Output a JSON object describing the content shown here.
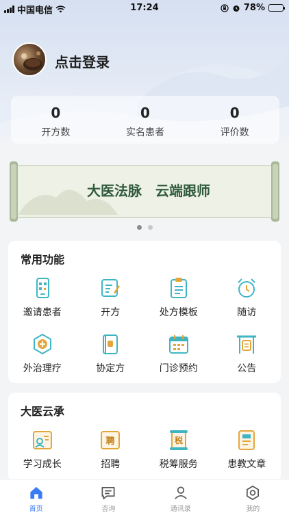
{
  "status_bar": {
    "carrier": "中国电信",
    "time": "17:24",
    "battery": "78%"
  },
  "profile": {
    "login_text": "点击登录"
  },
  "stats": [
    {
      "value": "0",
      "label": "开方数"
    },
    {
      "value": "0",
      "label": "实名患者"
    },
    {
      "value": "0",
      "label": "评价数"
    }
  ],
  "banner": {
    "text": "大医法脉　云端跟师",
    "slide_count": 2,
    "active_slide": 0
  },
  "common_functions": {
    "title": "常用功能",
    "items": [
      {
        "label": "邀请患者",
        "icon": "qr-phone-icon"
      },
      {
        "label": "开方",
        "icon": "prescribe-pen-icon"
      },
      {
        "label": "处方模板",
        "icon": "clipboard-template-icon"
      },
      {
        "label": "随访",
        "icon": "alarm-clock-icon"
      },
      {
        "label": "外治理疗",
        "icon": "plus-hexagon-icon"
      },
      {
        "label": "协定方",
        "icon": "agreement-book-icon"
      },
      {
        "label": "门诊预约",
        "icon": "calendar-icon"
      },
      {
        "label": "公告",
        "icon": "announcement-gate-icon"
      }
    ]
  },
  "cloud_section": {
    "title": "大医云承",
    "items": [
      {
        "label": "学习成长",
        "icon": "learning-icon",
        "glyph": ""
      },
      {
        "label": "招聘",
        "icon": "recruit-icon",
        "glyph": "聘"
      },
      {
        "label": "税筹服务",
        "icon": "tax-scroll-icon",
        "glyph": "税"
      },
      {
        "label": "患教文章",
        "icon": "article-book-icon",
        "glyph": ""
      }
    ]
  },
  "tab_bar": [
    {
      "label": "首页",
      "icon": "home-icon",
      "active": true
    },
    {
      "label": "咨询",
      "icon": "consult-icon",
      "active": false
    },
    {
      "label": "通讯录",
      "icon": "contacts-icon",
      "active": false
    },
    {
      "label": "我的",
      "icon": "profile-settings-icon",
      "active": false
    }
  ],
  "colors": {
    "accent": "#3a7bf6",
    "icon_teal": "#3fb5c4",
    "icon_gold": "#e3a63b",
    "banner_green": "#2f5a3b"
  }
}
